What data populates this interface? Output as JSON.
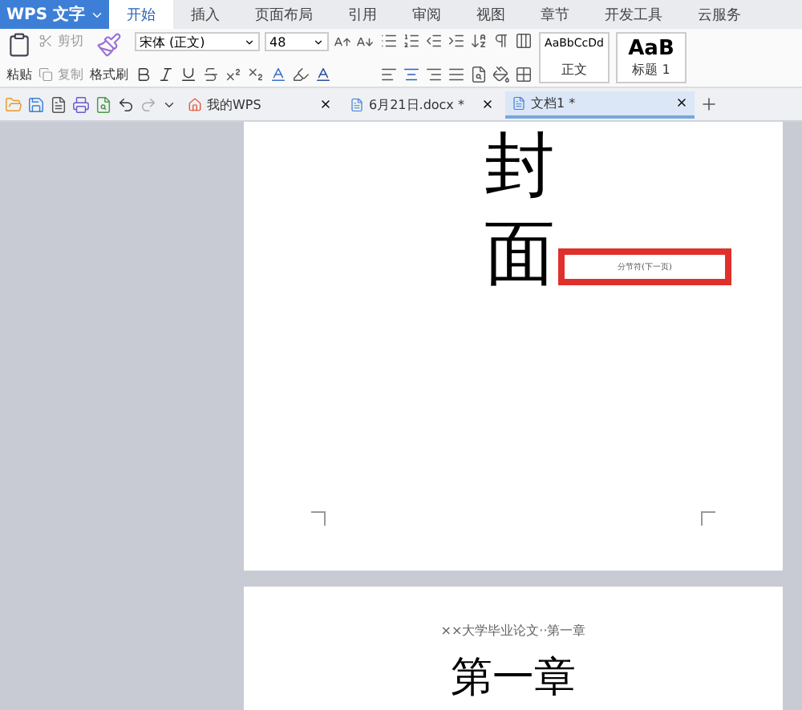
{
  "app": {
    "title": "WPS 文字"
  },
  "menu_tabs": [
    {
      "label": "开始",
      "selected": true
    },
    {
      "label": "插入",
      "selected": false
    },
    {
      "label": "页面布局",
      "selected": false
    },
    {
      "label": "引用",
      "selected": false
    },
    {
      "label": "审阅",
      "selected": false
    },
    {
      "label": "视图",
      "selected": false
    },
    {
      "label": "章节",
      "selected": false
    },
    {
      "label": "开发工具",
      "selected": false
    },
    {
      "label": "云服务",
      "selected": false
    }
  ],
  "ribbon": {
    "paste": "粘贴",
    "cut": "剪切",
    "copy": "复制",
    "format_painter": "格式刷",
    "font": "宋体 (正文)",
    "font_size": "48",
    "styles": [
      {
        "sample": "AaBbCcDd",
        "name": "正文",
        "kind": "body"
      },
      {
        "sample": "AaB",
        "name": "标题 1",
        "kind": "heading"
      }
    ]
  },
  "doc_tabs": [
    {
      "label": "我的WPS",
      "kind": "home",
      "selected": false
    },
    {
      "label": "6月21日.docx *",
      "kind": "doc",
      "selected": false
    },
    {
      "label": "文档1 *",
      "kind": "doc",
      "selected": true
    }
  ],
  "pages": [
    {
      "title_chars": [
        "封",
        "面"
      ],
      "section_break": "分节符(下一页)"
    },
    {
      "header": "××大学毕业论文··第一章",
      "heading": "第一章"
    }
  ]
}
